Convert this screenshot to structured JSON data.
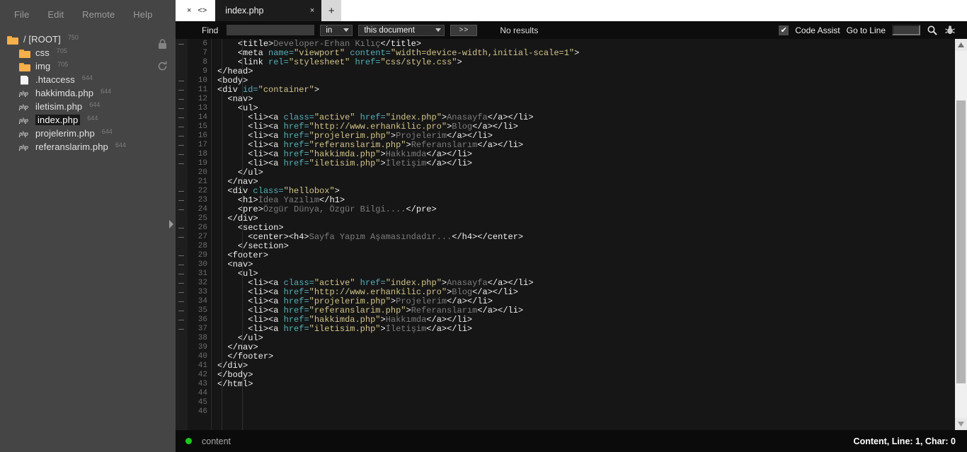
{
  "menu": {
    "items": [
      {
        "label": "File",
        "name": "menu-file"
      },
      {
        "label": "Edit",
        "name": "menu-edit"
      },
      {
        "label": "Remote",
        "name": "menu-remote"
      },
      {
        "label": "Help",
        "name": "menu-help"
      }
    ]
  },
  "filetree": {
    "items": [
      {
        "icon": "folder-icon",
        "label": "/ [ROOT]",
        "perm": "750",
        "indent": 0,
        "kind": "folder",
        "selected": false
      },
      {
        "icon": "folder-icon",
        "label": "css",
        "perm": "705",
        "indent": 1,
        "kind": "folder",
        "selected": false
      },
      {
        "icon": "folder-icon",
        "label": "img",
        "perm": "705",
        "indent": 1,
        "kind": "folder",
        "selected": false
      },
      {
        "icon": "file-icon",
        "label": ".htaccess",
        "perm": "644",
        "indent": 1,
        "kind": "file",
        "selected": false
      },
      {
        "icon": "php-file-icon",
        "label": "hakkimda.php",
        "perm": "644",
        "indent": 1,
        "kind": "php",
        "selected": false
      },
      {
        "icon": "php-file-icon",
        "label": "iletisim.php",
        "perm": "644",
        "indent": 1,
        "kind": "php",
        "selected": false
      },
      {
        "icon": "php-file-icon",
        "label": "index.php",
        "perm": "644",
        "indent": 1,
        "kind": "php",
        "selected": true
      },
      {
        "icon": "php-file-icon",
        "label": "projelerim.php",
        "perm": "644",
        "indent": 1,
        "kind": "php",
        "selected": false
      },
      {
        "icon": "php-file-icon",
        "label": "referanslarim.php",
        "perm": "644",
        "indent": 1,
        "kind": "php",
        "selected": false
      }
    ],
    "tools": [
      {
        "name": "lock-icon"
      },
      {
        "name": "refresh-icon"
      }
    ],
    "collapse": {
      "name": "panel-collapse-arrow-icon"
    }
  },
  "tabbar": {
    "close_all_icon": "×",
    "code_view_icon": "<>",
    "tabs": [
      {
        "label": "index.php",
        "close": "×",
        "active": true
      }
    ],
    "add_label": "+"
  },
  "findbar": {
    "find_label": "Find",
    "find_value": "",
    "find_placeholder": "",
    "scope_prefix": "in",
    "scope_value": "this document",
    "more_label": ">>",
    "results_label": "No results",
    "code_assist_label": "Code Assist",
    "code_assist_checked": "✔",
    "goto_line_label": "Go to Line",
    "goto_line_value": "",
    "search_icon": "search-icon",
    "bug_icon": "bug-icon"
  },
  "editor": {
    "first_visible_line": 6,
    "last_visible_line": 46,
    "lines": [
      {
        "n": 6,
        "fold": true,
        "tokens": [
          {
            "t": "plain",
            "v": "    "
          },
          {
            "t": "tag",
            "v": "<title>"
          },
          {
            "t": "text",
            "v": "Developer-Erhan Kılıç"
          },
          {
            "t": "tag",
            "v": "</title>"
          }
        ]
      },
      {
        "n": 7,
        "fold": false,
        "tokens": [
          {
            "t": "plain",
            "v": "    "
          },
          {
            "t": "tag",
            "v": "<meta "
          },
          {
            "t": "attr",
            "v": "name="
          },
          {
            "t": "val",
            "v": "\"viewport\""
          },
          {
            "t": "plain",
            "v": " "
          },
          {
            "t": "attr",
            "v": "content="
          },
          {
            "t": "val",
            "v": "\"width=device-width,initial-scale=1\""
          },
          {
            "t": "tag",
            "v": ">"
          }
        ]
      },
      {
        "n": 8,
        "fold": false,
        "tokens": [
          {
            "t": "plain",
            "v": "    "
          },
          {
            "t": "tag",
            "v": "<link "
          },
          {
            "t": "attr",
            "v": "rel="
          },
          {
            "t": "val",
            "v": "\"stylesheet\""
          },
          {
            "t": "plain",
            "v": " "
          },
          {
            "t": "attr",
            "v": "href="
          },
          {
            "t": "val",
            "v": "\"css/style.css\""
          },
          {
            "t": "tag",
            "v": ">"
          }
        ]
      },
      {
        "n": 9,
        "fold": false,
        "tokens": [
          {
            "t": "tag",
            "v": "</head>"
          }
        ]
      },
      {
        "n": 10,
        "fold": true,
        "tokens": [
          {
            "t": "tag",
            "v": "<body>"
          }
        ]
      },
      {
        "n": 11,
        "fold": true,
        "tokens": [
          {
            "t": "tag",
            "v": "<div "
          },
          {
            "t": "attr",
            "v": "id="
          },
          {
            "t": "val",
            "v": "\"container\""
          },
          {
            "t": "tag",
            "v": ">"
          }
        ]
      },
      {
        "n": 12,
        "fold": true,
        "tokens": [
          {
            "t": "plain",
            "v": "  "
          },
          {
            "t": "tag",
            "v": "<nav>"
          }
        ]
      },
      {
        "n": 13,
        "fold": true,
        "tokens": [
          {
            "t": "plain",
            "v": "    "
          },
          {
            "t": "tag",
            "v": "<ul>"
          }
        ]
      },
      {
        "n": 14,
        "fold": true,
        "tokens": [
          {
            "t": "plain",
            "v": "      "
          },
          {
            "t": "tag",
            "v": "<li><a "
          },
          {
            "t": "attr",
            "v": "class="
          },
          {
            "t": "val",
            "v": "\"active\""
          },
          {
            "t": "plain",
            "v": " "
          },
          {
            "t": "attr",
            "v": "href="
          },
          {
            "t": "val",
            "v": "\"index.php\""
          },
          {
            "t": "tag",
            "v": ">"
          },
          {
            "t": "text",
            "v": "Anasayfa"
          },
          {
            "t": "tag",
            "v": "</a></li>"
          }
        ]
      },
      {
        "n": 15,
        "fold": true,
        "tokens": [
          {
            "t": "plain",
            "v": "      "
          },
          {
            "t": "tag",
            "v": "<li><a "
          },
          {
            "t": "attr",
            "v": "href="
          },
          {
            "t": "val",
            "v": "\"http://www.erhankilic.pro\""
          },
          {
            "t": "tag",
            "v": ">"
          },
          {
            "t": "text",
            "v": "Blog"
          },
          {
            "t": "tag",
            "v": "</a></li>"
          }
        ]
      },
      {
        "n": 16,
        "fold": true,
        "tokens": [
          {
            "t": "plain",
            "v": "      "
          },
          {
            "t": "tag",
            "v": "<li><a "
          },
          {
            "t": "attr",
            "v": "href="
          },
          {
            "t": "val",
            "v": "\"projelerim.php\""
          },
          {
            "t": "tag",
            "v": ">"
          },
          {
            "t": "text",
            "v": "Projelerim"
          },
          {
            "t": "tag",
            "v": "</a></li>"
          }
        ]
      },
      {
        "n": 17,
        "fold": true,
        "tokens": [
          {
            "t": "plain",
            "v": "      "
          },
          {
            "t": "tag",
            "v": "<li><a "
          },
          {
            "t": "attr",
            "v": "href="
          },
          {
            "t": "val",
            "v": "\"referanslarim.php\""
          },
          {
            "t": "tag",
            "v": ">"
          },
          {
            "t": "text",
            "v": "Referanslarım"
          },
          {
            "t": "tag",
            "v": "</a></li>"
          }
        ]
      },
      {
        "n": 18,
        "fold": true,
        "tokens": [
          {
            "t": "plain",
            "v": "      "
          },
          {
            "t": "tag",
            "v": "<li><a "
          },
          {
            "t": "attr",
            "v": "href="
          },
          {
            "t": "val",
            "v": "\"hakkimda.php\""
          },
          {
            "t": "tag",
            "v": ">"
          },
          {
            "t": "text",
            "v": "Hakkımda"
          },
          {
            "t": "tag",
            "v": "</a></li>"
          }
        ]
      },
      {
        "n": 19,
        "fold": true,
        "tokens": [
          {
            "t": "plain",
            "v": "      "
          },
          {
            "t": "tag",
            "v": "<li><a "
          },
          {
            "t": "attr",
            "v": "href="
          },
          {
            "t": "val",
            "v": "\"iletisim.php\""
          },
          {
            "t": "tag",
            "v": ">"
          },
          {
            "t": "text",
            "v": "İletişim"
          },
          {
            "t": "tag",
            "v": "</a></li>"
          }
        ]
      },
      {
        "n": 20,
        "fold": false,
        "tokens": [
          {
            "t": "plain",
            "v": "    "
          },
          {
            "t": "tag",
            "v": "</ul>"
          }
        ]
      },
      {
        "n": 21,
        "fold": false,
        "tokens": [
          {
            "t": "plain",
            "v": "  "
          },
          {
            "t": "tag",
            "v": "</nav>"
          }
        ]
      },
      {
        "n": 22,
        "fold": true,
        "tokens": [
          {
            "t": "plain",
            "v": "  "
          },
          {
            "t": "tag",
            "v": "<div "
          },
          {
            "t": "attr",
            "v": "class="
          },
          {
            "t": "val",
            "v": "\"hellobox\""
          },
          {
            "t": "tag",
            "v": ">"
          }
        ]
      },
      {
        "n": 23,
        "fold": true,
        "tokens": [
          {
            "t": "plain",
            "v": "    "
          },
          {
            "t": "tag",
            "v": "<h1>"
          },
          {
            "t": "text",
            "v": "İdea Yazılım"
          },
          {
            "t": "tag",
            "v": "</h1>"
          }
        ]
      },
      {
        "n": 24,
        "fold": true,
        "tokens": [
          {
            "t": "plain",
            "v": "    "
          },
          {
            "t": "tag",
            "v": "<pre>"
          },
          {
            "t": "text",
            "v": "Özgür Dünya, Özgür Bilgi...."
          },
          {
            "t": "tag",
            "v": "</pre>"
          }
        ]
      },
      {
        "n": 25,
        "fold": false,
        "tokens": [
          {
            "t": "plain",
            "v": "  "
          },
          {
            "t": "tag",
            "v": "</div>"
          }
        ]
      },
      {
        "n": 26,
        "fold": true,
        "tokens": [
          {
            "t": "plain",
            "v": "    "
          },
          {
            "t": "tag",
            "v": "<section>"
          }
        ]
      },
      {
        "n": 27,
        "fold": true,
        "tokens": [
          {
            "t": "plain",
            "v": "      "
          },
          {
            "t": "tag",
            "v": "<center><h4>"
          },
          {
            "t": "text",
            "v": "Sayfa Yapım Aşamasındadır..."
          },
          {
            "t": "tag",
            "v": "</h4></center>"
          }
        ]
      },
      {
        "n": 28,
        "fold": false,
        "tokens": [
          {
            "t": "plain",
            "v": "    "
          },
          {
            "t": "tag",
            "v": "</section>"
          }
        ]
      },
      {
        "n": 29,
        "fold": true,
        "tokens": [
          {
            "t": "plain",
            "v": "  "
          },
          {
            "t": "tag",
            "v": "<footer>"
          }
        ]
      },
      {
        "n": 30,
        "fold": true,
        "tokens": [
          {
            "t": "plain",
            "v": "  "
          },
          {
            "t": "tag",
            "v": "<nav>"
          }
        ]
      },
      {
        "n": 31,
        "fold": true,
        "tokens": [
          {
            "t": "plain",
            "v": "    "
          },
          {
            "t": "tag",
            "v": "<ul>"
          }
        ]
      },
      {
        "n": 32,
        "fold": true,
        "tokens": [
          {
            "t": "plain",
            "v": "      "
          },
          {
            "t": "tag",
            "v": "<li><a "
          },
          {
            "t": "attr",
            "v": "class="
          },
          {
            "t": "val",
            "v": "\"active\""
          },
          {
            "t": "plain",
            "v": " "
          },
          {
            "t": "attr",
            "v": "href="
          },
          {
            "t": "val",
            "v": "\"index.php\""
          },
          {
            "t": "tag",
            "v": ">"
          },
          {
            "t": "text",
            "v": "Anasayfa"
          },
          {
            "t": "tag",
            "v": "</a></li>"
          }
        ]
      },
      {
        "n": 33,
        "fold": true,
        "tokens": [
          {
            "t": "plain",
            "v": "      "
          },
          {
            "t": "tag",
            "v": "<li><a "
          },
          {
            "t": "attr",
            "v": "href="
          },
          {
            "t": "val",
            "v": "\"http://www.erhankilic.pro\""
          },
          {
            "t": "tag",
            "v": ">"
          },
          {
            "t": "text",
            "v": "Blog"
          },
          {
            "t": "tag",
            "v": "</a></li>"
          }
        ]
      },
      {
        "n": 34,
        "fold": true,
        "tokens": [
          {
            "t": "plain",
            "v": "      "
          },
          {
            "t": "tag",
            "v": "<li><a "
          },
          {
            "t": "attr",
            "v": "href="
          },
          {
            "t": "val",
            "v": "\"projelerim.php\""
          },
          {
            "t": "tag",
            "v": ">"
          },
          {
            "t": "text",
            "v": "Projelerim"
          },
          {
            "t": "tag",
            "v": "</a></li>"
          }
        ]
      },
      {
        "n": 35,
        "fold": true,
        "tokens": [
          {
            "t": "plain",
            "v": "      "
          },
          {
            "t": "tag",
            "v": "<li><a "
          },
          {
            "t": "attr",
            "v": "href="
          },
          {
            "t": "val",
            "v": "\"referanslarim.php\""
          },
          {
            "t": "tag",
            "v": ">"
          },
          {
            "t": "text",
            "v": "Referanslarım"
          },
          {
            "t": "tag",
            "v": "</a></li>"
          }
        ]
      },
      {
        "n": 36,
        "fold": true,
        "tokens": [
          {
            "t": "plain",
            "v": "      "
          },
          {
            "t": "tag",
            "v": "<li><a "
          },
          {
            "t": "attr",
            "v": "href="
          },
          {
            "t": "val",
            "v": "\"hakkimda.php\""
          },
          {
            "t": "tag",
            "v": ">"
          },
          {
            "t": "text",
            "v": "Hakkımda"
          },
          {
            "t": "tag",
            "v": "</a></li>"
          }
        ]
      },
      {
        "n": 37,
        "fold": true,
        "tokens": [
          {
            "t": "plain",
            "v": "      "
          },
          {
            "t": "tag",
            "v": "<li><a "
          },
          {
            "t": "attr",
            "v": "href="
          },
          {
            "t": "val",
            "v": "\"iletisim.php\""
          },
          {
            "t": "tag",
            "v": ">"
          },
          {
            "t": "text",
            "v": "İletişim"
          },
          {
            "t": "tag",
            "v": "</a></li>"
          }
        ]
      },
      {
        "n": 38,
        "fold": false,
        "tokens": [
          {
            "t": "plain",
            "v": "    "
          },
          {
            "t": "tag",
            "v": "</ul>"
          }
        ]
      },
      {
        "n": 39,
        "fold": false,
        "tokens": [
          {
            "t": "plain",
            "v": "  "
          },
          {
            "t": "tag",
            "v": "</nav>"
          }
        ]
      },
      {
        "n": 40,
        "fold": false,
        "tokens": [
          {
            "t": "plain",
            "v": "  "
          },
          {
            "t": "tag",
            "v": "</footer>"
          }
        ]
      },
      {
        "n": 41,
        "fold": false,
        "tokens": [
          {
            "t": "tag",
            "v": "</div>"
          }
        ]
      },
      {
        "n": 42,
        "fold": false,
        "tokens": [
          {
            "t": "tag",
            "v": "</body>"
          }
        ]
      },
      {
        "n": 43,
        "fold": false,
        "tokens": [
          {
            "t": "tag",
            "v": "</html>"
          }
        ]
      },
      {
        "n": 44,
        "fold": false,
        "tokens": []
      },
      {
        "n": 45,
        "fold": false,
        "tokens": []
      },
      {
        "n": 46,
        "fold": false,
        "tokens": []
      }
    ]
  },
  "scrollbar": {
    "up_arrow": "▲",
    "down_arrow": "▼"
  },
  "statusbar": {
    "indicator_color": "#17cc17",
    "left_label": "content",
    "right_label": "Content, Line: 1, Char: 0"
  },
  "colors": {
    "panel_bg": "#454545",
    "editor_bg": "#161616",
    "folder": "#f7b04a",
    "tag": "#f0f0f0",
    "attr": "#53b0b8",
    "value": "#d2c38a",
    "text": "#7d7d7d",
    "status_green": "#17cc17"
  }
}
